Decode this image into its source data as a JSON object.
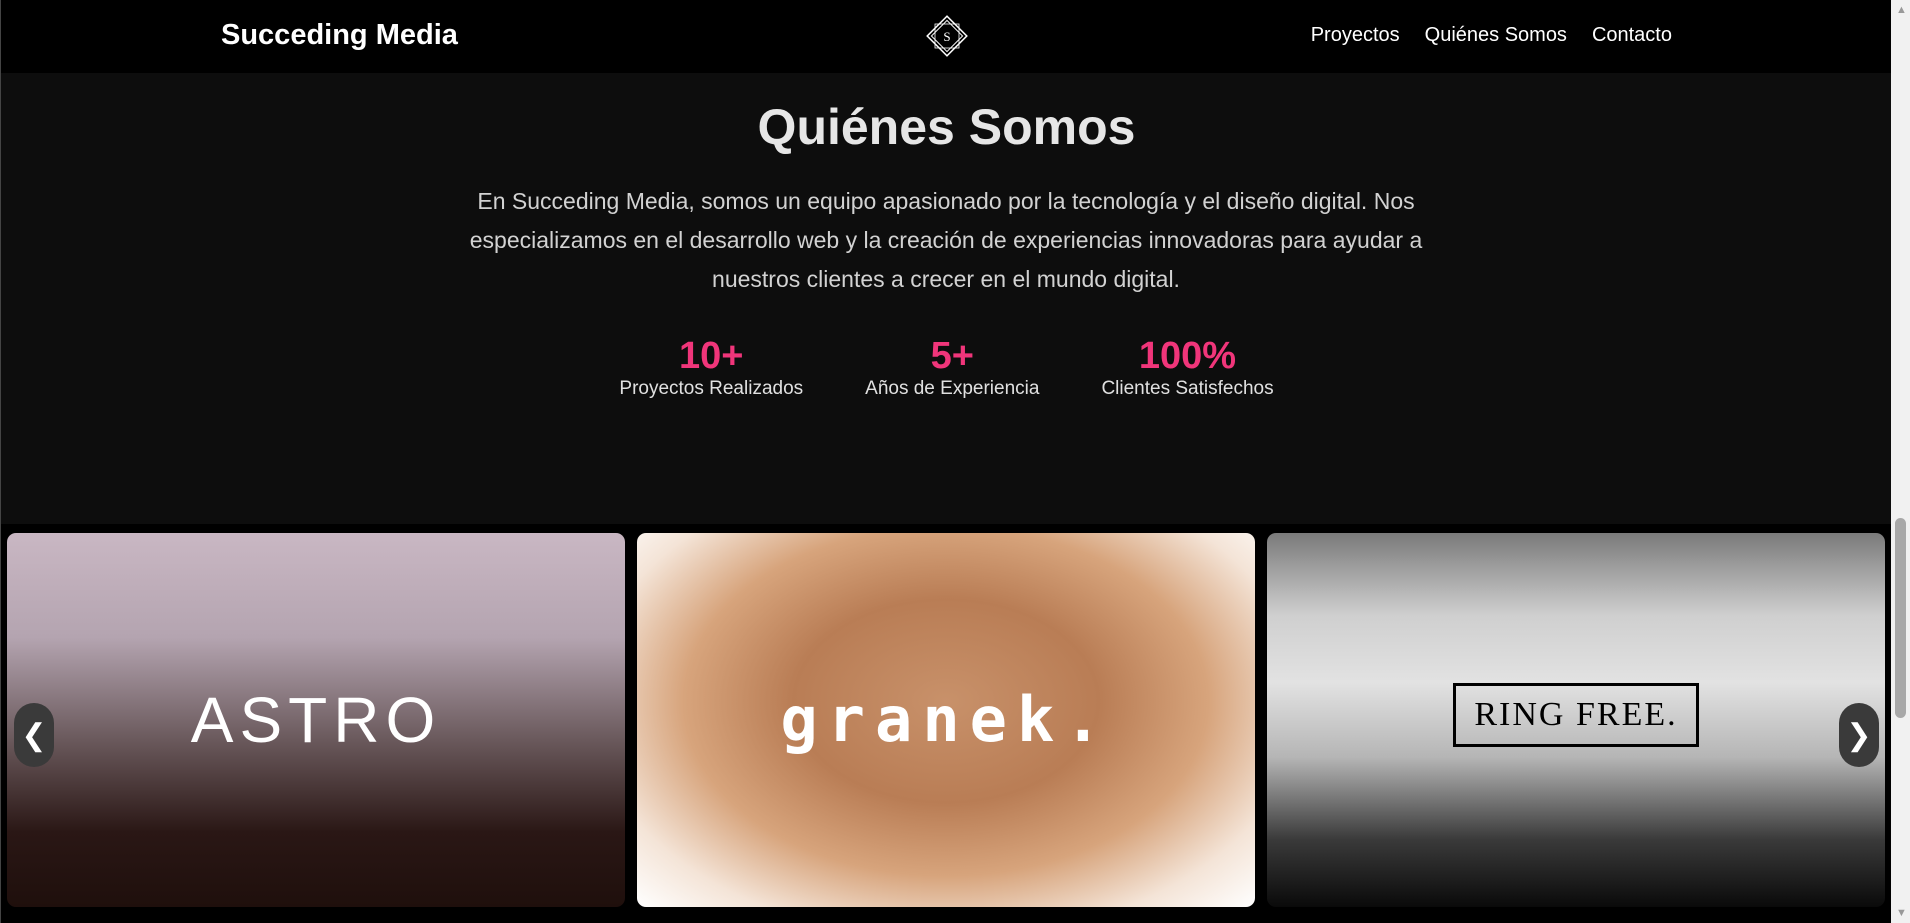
{
  "navbar": {
    "brand": "Succeding Media",
    "logo_letter": "S",
    "links": [
      "Proyectos",
      "Quiénes Somos",
      "Contacto"
    ]
  },
  "about": {
    "title": "Quiénes Somos",
    "description": "En Succeding Media, somos un equipo apasionado por la tecnología y el diseño digital. Nos especializamos en el desarrollo web y la creación de experiencias innovadoras para ayudar a nuestros clientes a crecer en el mundo digital.",
    "stats": [
      {
        "value": "10+",
        "label": "Proyectos Realizados"
      },
      {
        "value": "5+",
        "label": "Años de Experiencia"
      },
      {
        "value": "100%",
        "label": "Clientes Satisfechos"
      }
    ]
  },
  "carousel": {
    "cards": [
      {
        "logo_text": "ASTRO"
      },
      {
        "logo_text": "granek."
      },
      {
        "logo_text": "RING FREE."
      }
    ],
    "prev_icon": "❮",
    "next_icon": "❯"
  },
  "colors": {
    "accent": "#f0357a",
    "navbar_bg": "#000000",
    "page_bg": "#0d0d0d"
  }
}
